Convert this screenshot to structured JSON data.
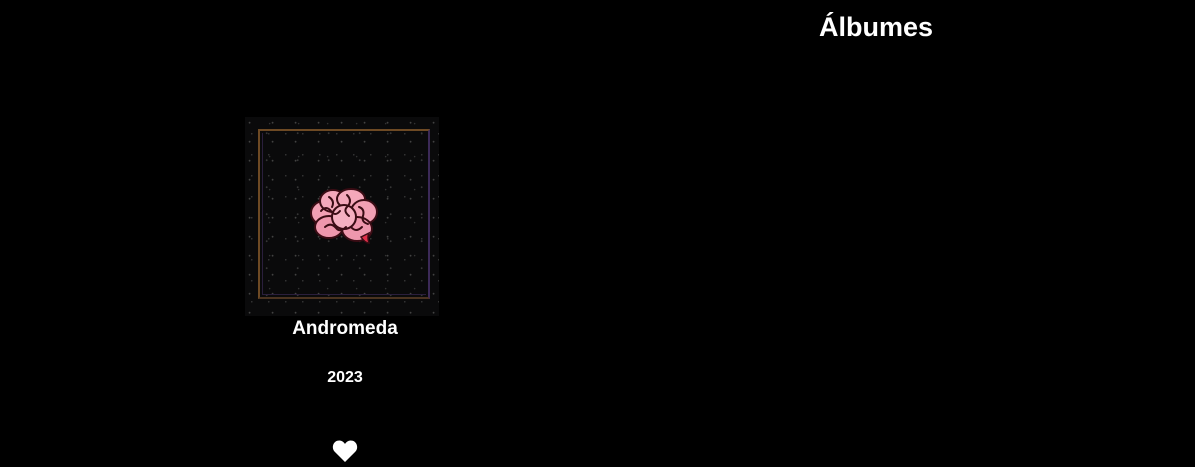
{
  "header": {
    "title": "Álbumes"
  },
  "albums": [
    {
      "name": "Andromeda",
      "year": "2023",
      "cover_icon": "brain-icon",
      "favorite_icon": "heart-icon",
      "favorite": true
    }
  ],
  "colors": {
    "background": "#000000",
    "text": "#ffffff",
    "frame_gold": "#6e4a24",
    "frame_purple": "#3c2a58",
    "brain_pink": "#f2a0b4"
  }
}
